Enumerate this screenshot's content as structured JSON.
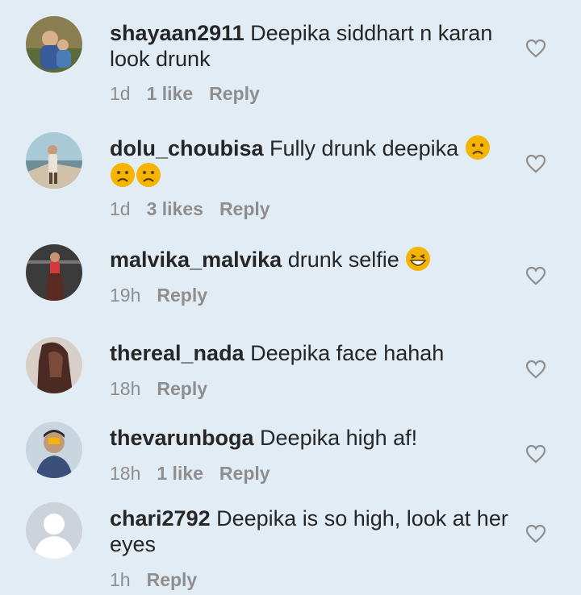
{
  "comments": [
    {
      "username": "shayaan2911",
      "text": "Deepika siddhart n karan look drunk",
      "time": "1d",
      "likes": "1 like",
      "reply": "Reply"
    },
    {
      "username": "dolu_choubisa",
      "text": "Fully drunk deepika",
      "time": "1d",
      "likes": "3 likes",
      "reply": "Reply",
      "emojis": [
        "frowning-face-emoji",
        "frowning-face-emoji",
        "frowning-face-emoji"
      ]
    },
    {
      "username": "malvika_malvika",
      "text": "drunk selfie",
      "time": "19h",
      "likes": "",
      "reply": "Reply",
      "emojis": [
        "grinning-face-emoji"
      ]
    },
    {
      "username": "thereal_nada",
      "text": "Deepika face hahah",
      "time": "18h",
      "likes": "",
      "reply": "Reply"
    },
    {
      "username": "thevarunboga",
      "text": "Deepika high af!",
      "time": "18h",
      "likes": "1 like",
      "reply": "Reply"
    },
    {
      "username": "chari2792",
      "text": "Deepika is so high, look at her eyes",
      "time": "1h",
      "likes": "",
      "reply": "Reply"
    }
  ],
  "colors": {
    "background": "#e2ecf5",
    "text": "#262626",
    "meta": "#8e8e8e",
    "emoji": "#f5b400"
  }
}
